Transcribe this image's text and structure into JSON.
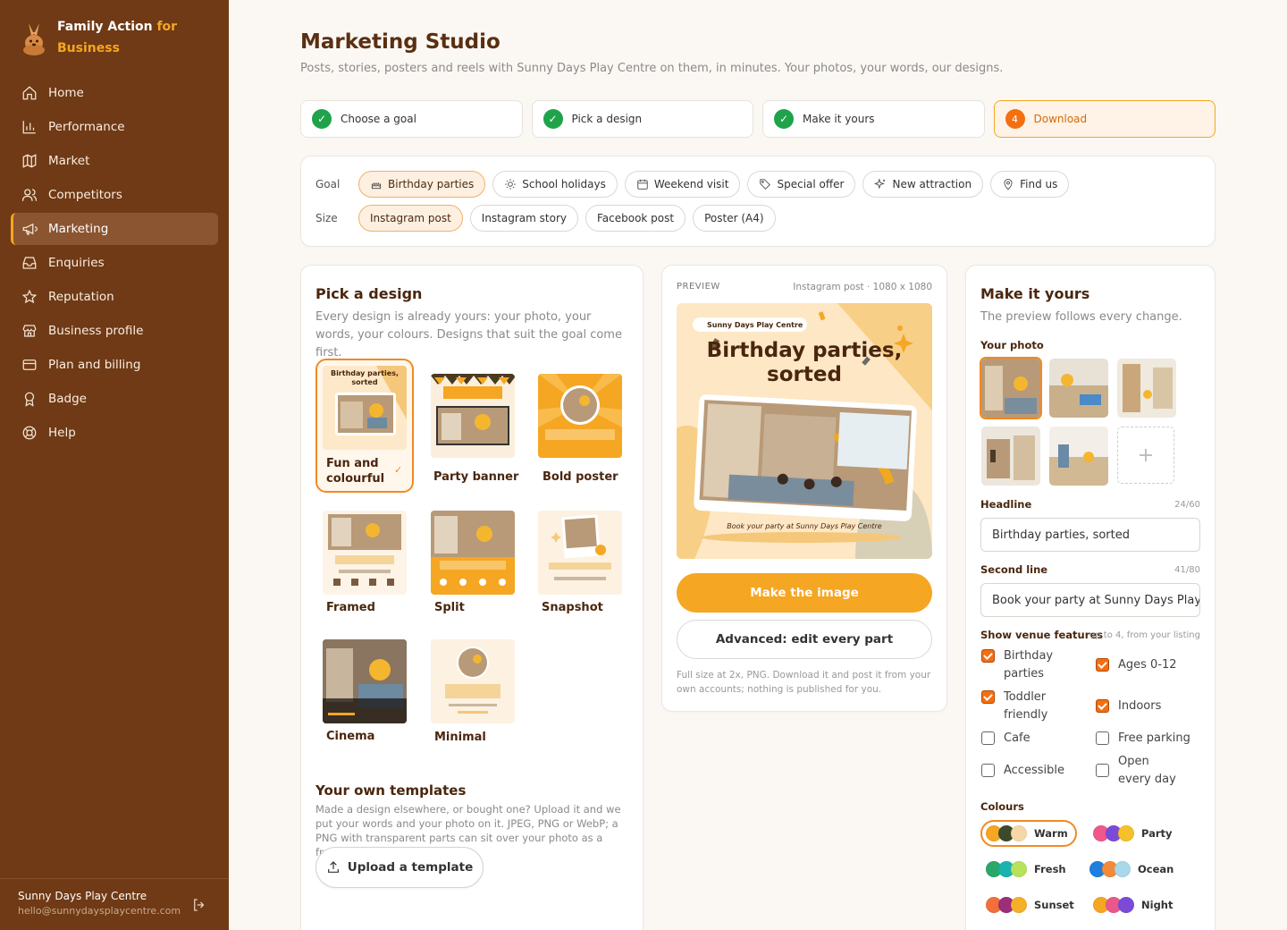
{
  "brand": {
    "name_main": "Family Action",
    "name_accent": "for Business"
  },
  "nav": [
    {
      "label": "Home",
      "icon": "home-icon"
    },
    {
      "label": "Performance",
      "icon": "bar-chart-icon"
    },
    {
      "label": "Market",
      "icon": "map-icon"
    },
    {
      "label": "Competitors",
      "icon": "users-icon"
    },
    {
      "label": "Marketing",
      "icon": "megaphone-icon",
      "active": true
    },
    {
      "label": "Enquiries",
      "icon": "inbox-icon"
    },
    {
      "label": "Reputation",
      "icon": "star-icon"
    },
    {
      "label": "Business profile",
      "icon": "store-icon"
    },
    {
      "label": "Plan and billing",
      "icon": "credit-card-icon"
    },
    {
      "label": "Badge",
      "icon": "badge-icon"
    },
    {
      "label": "Help",
      "icon": "lifebuoy-icon"
    }
  ],
  "account": {
    "name": "Sunny Days Play Centre",
    "email": "hello@sunnydaysplaycentre.com"
  },
  "page": {
    "title": "Marketing Studio",
    "subtitle": "Posts, stories, posters and reels with Sunny Days Play Centre on them, in minutes. Your photos, your words, our designs."
  },
  "steps": [
    {
      "label": "Choose a goal",
      "done": true
    },
    {
      "label": "Pick a design",
      "done": true
    },
    {
      "label": "Make it yours",
      "done": true
    },
    {
      "label": "Download",
      "number": "4",
      "current": true
    }
  ],
  "filters": {
    "goal_label": "Goal",
    "size_label": "Size",
    "goals": [
      "Birthday parties",
      "School holidays",
      "Weekend visit",
      "Special offer",
      "New attraction",
      "Find us"
    ],
    "selected_goal": "Birthday parties",
    "sizes": [
      "Instagram post",
      "Instagram story",
      "Facebook post",
      "Poster (A4)"
    ],
    "selected_size": "Instagram post"
  },
  "designs": {
    "title": "Pick a design",
    "description": "Every design is already yours: your photo, your words, your colours. Designs that suit the goal come first.",
    "items": [
      "Fun and colourful",
      "Party banner",
      "Bold poster",
      "Framed",
      "Split",
      "Snapshot",
      "Cinema",
      "Minimal"
    ],
    "selected": "Fun and colourful",
    "own_title": "Your own templates",
    "own_description": "Made a design elsewhere, or bought one? Upload it and we put your words and your photo on it. JPEG, PNG or WebP; a PNG with transparent parts can sit over your photo as a frame.",
    "upload_label": "Upload a template"
  },
  "preview": {
    "label": "PREVIEW",
    "size": "Instagram post · 1080 x 1080",
    "venue_tag": "Sunny Days Play Centre",
    "headline": "Birthday parties, sorted",
    "second_line": "Book your party at Sunny Days Play Centre",
    "make_button": "Make the image",
    "advanced_button": "Advanced: edit every part",
    "note": "Full size at 2x, PNG. Download it and post it from your own accounts; nothing is published for you."
  },
  "customize": {
    "title": "Make it yours",
    "description": "The preview follows every change.",
    "photo_label": "Your photo",
    "headline_label": "Headline",
    "headline_count": "24/60",
    "headline_value": "Birthday parties, sorted",
    "second_label": "Second line",
    "second_count": "41/80",
    "second_value": "Book your party at Sunny Days Play Centre",
    "features_label": "Show venue features",
    "features_hint": "up to 4, from your listing",
    "features": [
      {
        "label": "Birthday parties",
        "checked": true
      },
      {
        "label": "Ages 0-12",
        "checked": true
      },
      {
        "label": "Toddler friendly",
        "checked": true
      },
      {
        "label": "Indoors",
        "checked": true
      },
      {
        "label": "Cafe",
        "checked": false
      },
      {
        "label": "Free parking",
        "checked": false
      },
      {
        "label": "Accessible",
        "checked": false
      },
      {
        "label": "Open every day",
        "checked": false
      }
    ],
    "colours_label": "Colours",
    "palettes": [
      {
        "name": "Warm",
        "colors": [
          "#f5a623",
          "#3d4a2a",
          "#f7d7a8"
        ],
        "selected": true
      },
      {
        "name": "Party",
        "colors": [
          "#f0588a",
          "#7b4bd8",
          "#f5c02a"
        ]
      },
      {
        "name": "Fresh",
        "colors": [
          "#2aa86a",
          "#1ab3b0",
          "#b7e35a"
        ]
      },
      {
        "name": "Ocean",
        "colors": [
          "#1e7fe0",
          "#f38a3a",
          "#a8d8ea"
        ]
      },
      {
        "name": "Sunset",
        "colors": [
          "#f36f3a",
          "#9b2f7a",
          "#f5b02a"
        ]
      },
      {
        "name": "Night",
        "colors": [
          "#f5a623",
          "#e8588a",
          "#7b4bd8"
        ]
      }
    ]
  },
  "colors": {
    "sidebar": "#6f3a15",
    "accent": "#f5a623",
    "brand_brown": "#4a260e",
    "success": "#1fa34a"
  }
}
